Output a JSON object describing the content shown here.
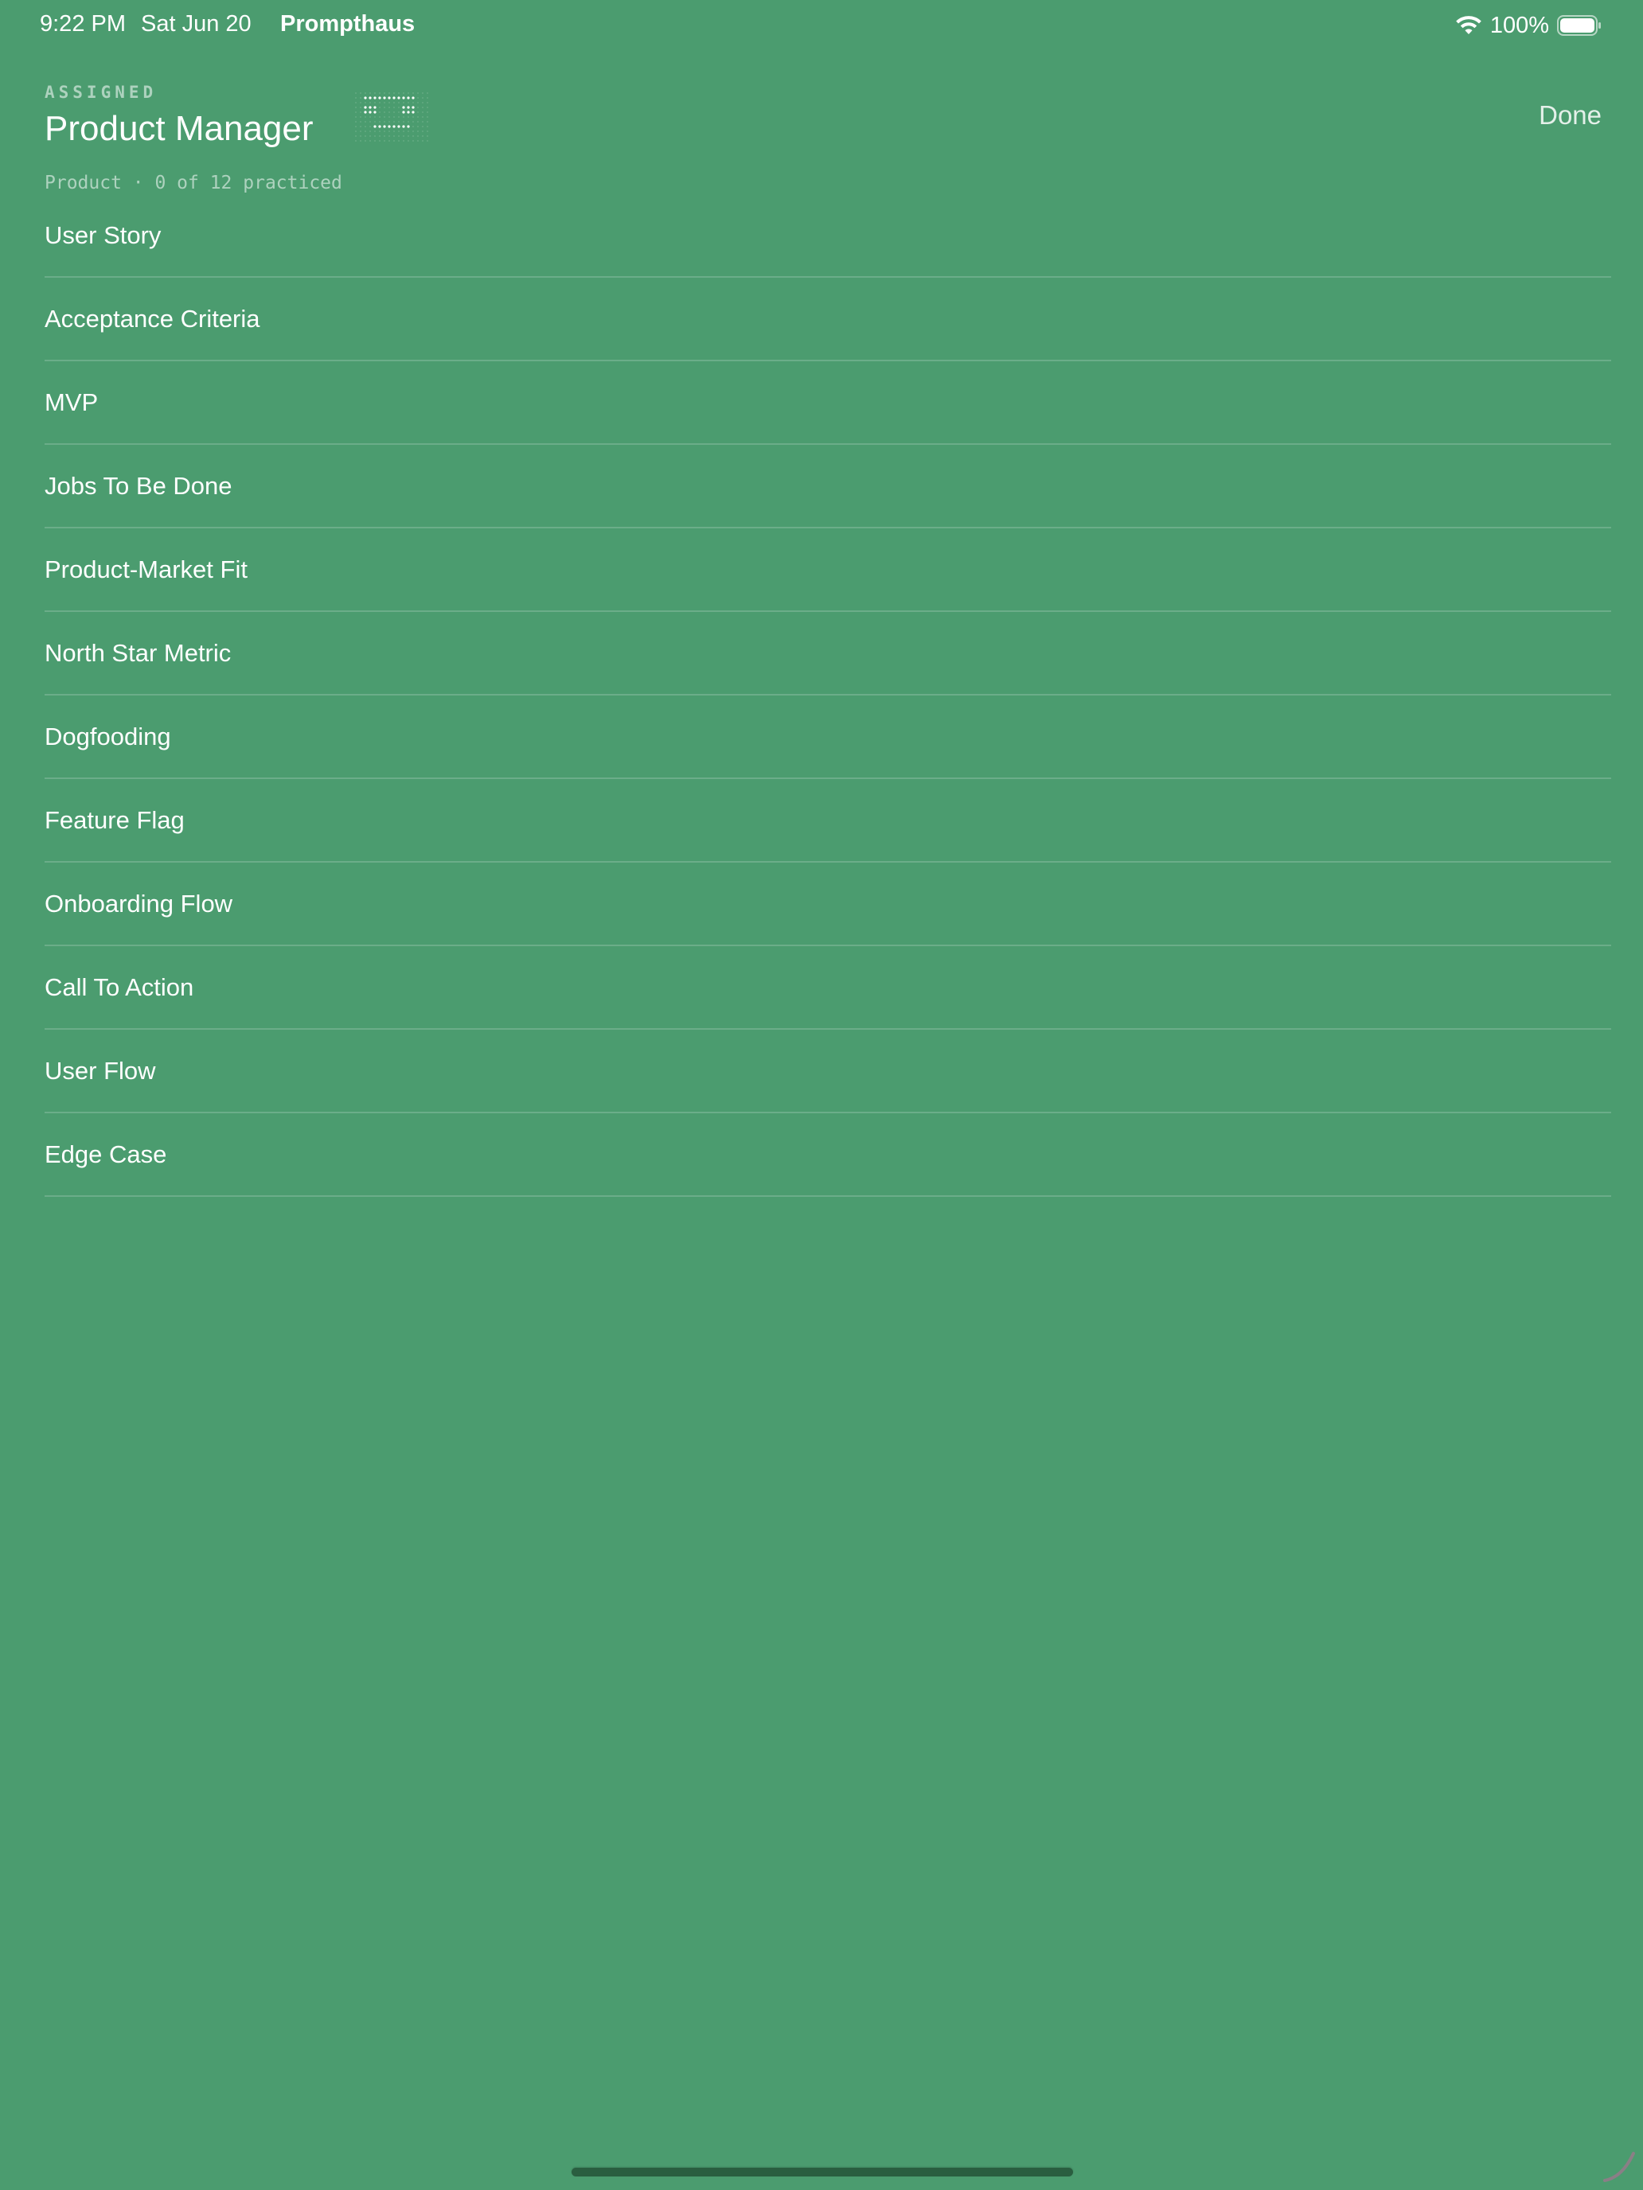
{
  "status_bar": {
    "time": "9:22 PM",
    "date": "Sat Jun 20",
    "app_name": "Prompthaus",
    "battery_percent": "100%",
    "wifi_icon": "wifi-icon",
    "battery_icon": "battery-icon"
  },
  "header": {
    "label": "ASSIGNED",
    "title": "Product Manager",
    "badge_icon": "dot-matrix-face-icon",
    "done_label": "Done",
    "subtitle": "Product · 0 of 12 practiced"
  },
  "terms": [
    {
      "label": "User Story"
    },
    {
      "label": "Acceptance Criteria"
    },
    {
      "label": "MVP"
    },
    {
      "label": "Jobs To Be Done"
    },
    {
      "label": "Product-Market Fit"
    },
    {
      "label": "North Star Metric"
    },
    {
      "label": "Dogfooding"
    },
    {
      "label": "Feature Flag"
    },
    {
      "label": "Onboarding Flow"
    },
    {
      "label": "Call To Action"
    },
    {
      "label": "User Flow"
    },
    {
      "label": "Edge Case"
    }
  ],
  "colors": {
    "background": "#4b9c6f",
    "text": "#ffffff",
    "divider": "rgba(255,255,255,0.18)"
  }
}
